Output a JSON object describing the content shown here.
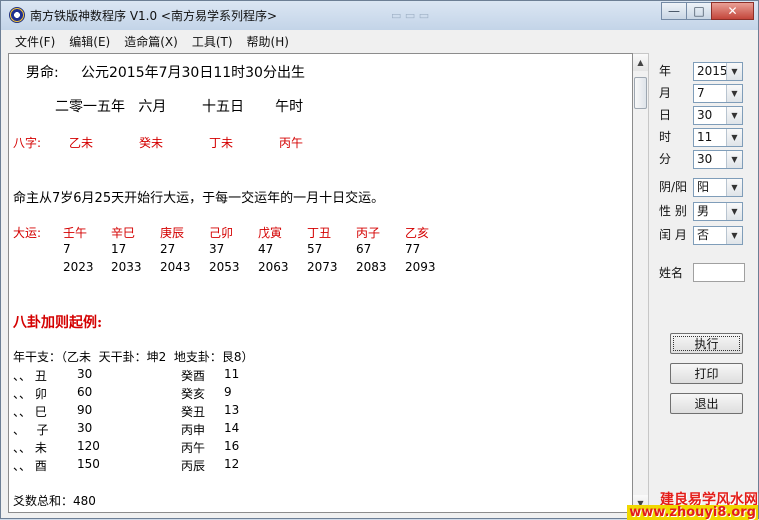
{
  "window": {
    "title": "南方铁版神数程序 V1.0   <南方易学系列程序>"
  },
  "menu": [
    "文件(F)",
    "编辑(E)",
    "造命篇(X)",
    "工具(T)",
    "帮助(H)"
  ],
  "report": {
    "gender_line": "男命:     公元2015年7月30日11时30分出生",
    "lunar_line": "二零一五年   六月        十五日       午时",
    "bazi": {
      "label": "八字:",
      "pillars": [
        "乙未",
        "癸未",
        "丁未",
        "丙午"
      ]
    },
    "dayun_intro": "命主从7岁6月25天开始行大运，于每一交运年的一月十日交运。",
    "dayun": {
      "label": "大运:",
      "pillars": [
        "壬午",
        "辛巳",
        "庚辰",
        "己卯",
        "戊寅",
        "丁丑",
        "丙子",
        "乙亥"
      ],
      "ages": [
        "7",
        "17",
        "27",
        "37",
        "47",
        "57",
        "67",
        "77"
      ],
      "years": [
        "2023",
        "2033",
        "2043",
        "2053",
        "2063",
        "2073",
        "2083",
        "2093"
      ]
    },
    "bagua_title": "八卦加则起例:",
    "year_stem_line": "年干支：（乙未  天干卦：坤2  地支卦：艮8）",
    "rows": [
      {
        "left": "、、 丑",
        "num1": "30",
        "right": "癸酉",
        "num2": "11"
      },
      {
        "left": "、、 卯",
        "num1": "60",
        "right": "癸亥",
        "num2": "9"
      },
      {
        "left": "、、 巳",
        "num1": "90",
        "right": "癸丑",
        "num2": "13"
      },
      {
        "left": "、   子",
        "num1": "30",
        "right": "丙申",
        "num2": "14"
      },
      {
        "left": "、、 未",
        "num1": "120",
        "right": "丙午",
        "num2": "16"
      },
      {
        "left": "、、 酉",
        "num1": "150",
        "right": "丙辰",
        "num2": "12"
      }
    ],
    "total_line": "爻数总和：480"
  },
  "side": {
    "fields": [
      {
        "label": "年",
        "value": "2015"
      },
      {
        "label": "月",
        "value": "7"
      },
      {
        "label": "日",
        "value": "30"
      },
      {
        "label": "时",
        "value": "11"
      },
      {
        "label": "分",
        "value": "30"
      },
      {
        "label": "阴/阳",
        "value": "阳"
      },
      {
        "label": "性 别",
        "value": "男"
      },
      {
        "label": "闰 月",
        "value": "否"
      }
    ],
    "name_label": "姓名",
    "name_value": "",
    "buttons": [
      "执行",
      "打印",
      "退出"
    ]
  },
  "watermark": {
    "line1": "建良易学风水网",
    "line2": "www.zhouyi8.org"
  }
}
